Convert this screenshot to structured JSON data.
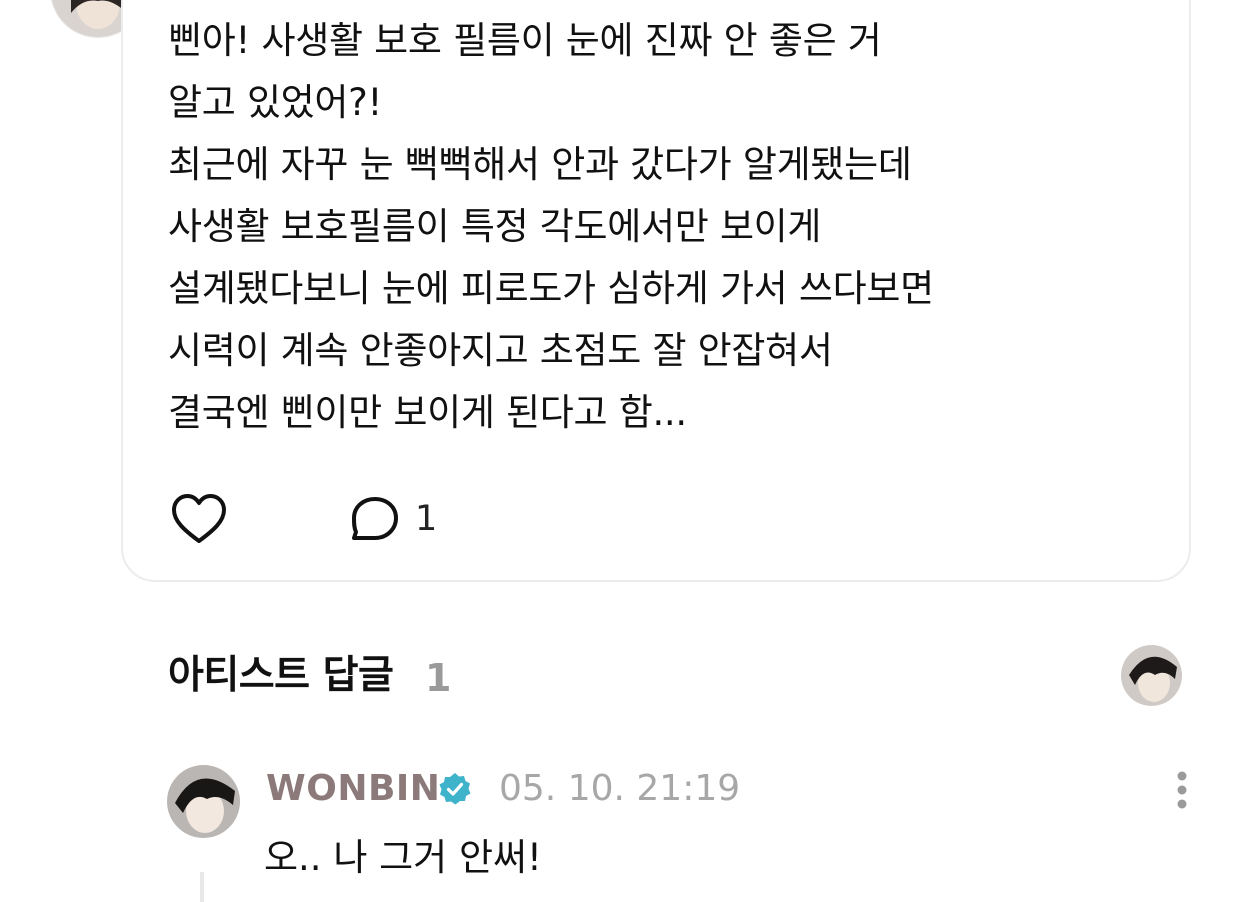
{
  "post": {
    "lines": [
      "삔아! 사생활 보호 필름이 눈에 진짜 안 좋은 거",
      "알고 있었어?!",
      "최근에 자꾸 눈 뻑뻑해서 안과 갔다가 알게됐는데",
      "사생활 보호필름이 특정 각도에서만 보이게",
      "설계됐다보니 눈에 피로도가 심하게 가서 쓰다보면",
      "시력이 계속 안좋아지고 초점도 잘 안잡혀서",
      "결국엔 삔이만 보이게 된다고 함..."
    ],
    "like_icon": "heart-icon",
    "comment_icon": "comment-bubble-icon",
    "comment_count": "1"
  },
  "artist_replies": {
    "title": "아티스트 답글",
    "count": "1"
  },
  "reply": {
    "author": "WONBIN",
    "verified_icon": "verified-badge-icon",
    "timestamp": "05. 10. 21:19",
    "text": "오.. 나 그거 안써!",
    "more_icon": "more-vertical-icon"
  },
  "colors": {
    "verified": "#3fb3c9",
    "author": "#8c7a7a",
    "muted": "#a7a7a7"
  }
}
